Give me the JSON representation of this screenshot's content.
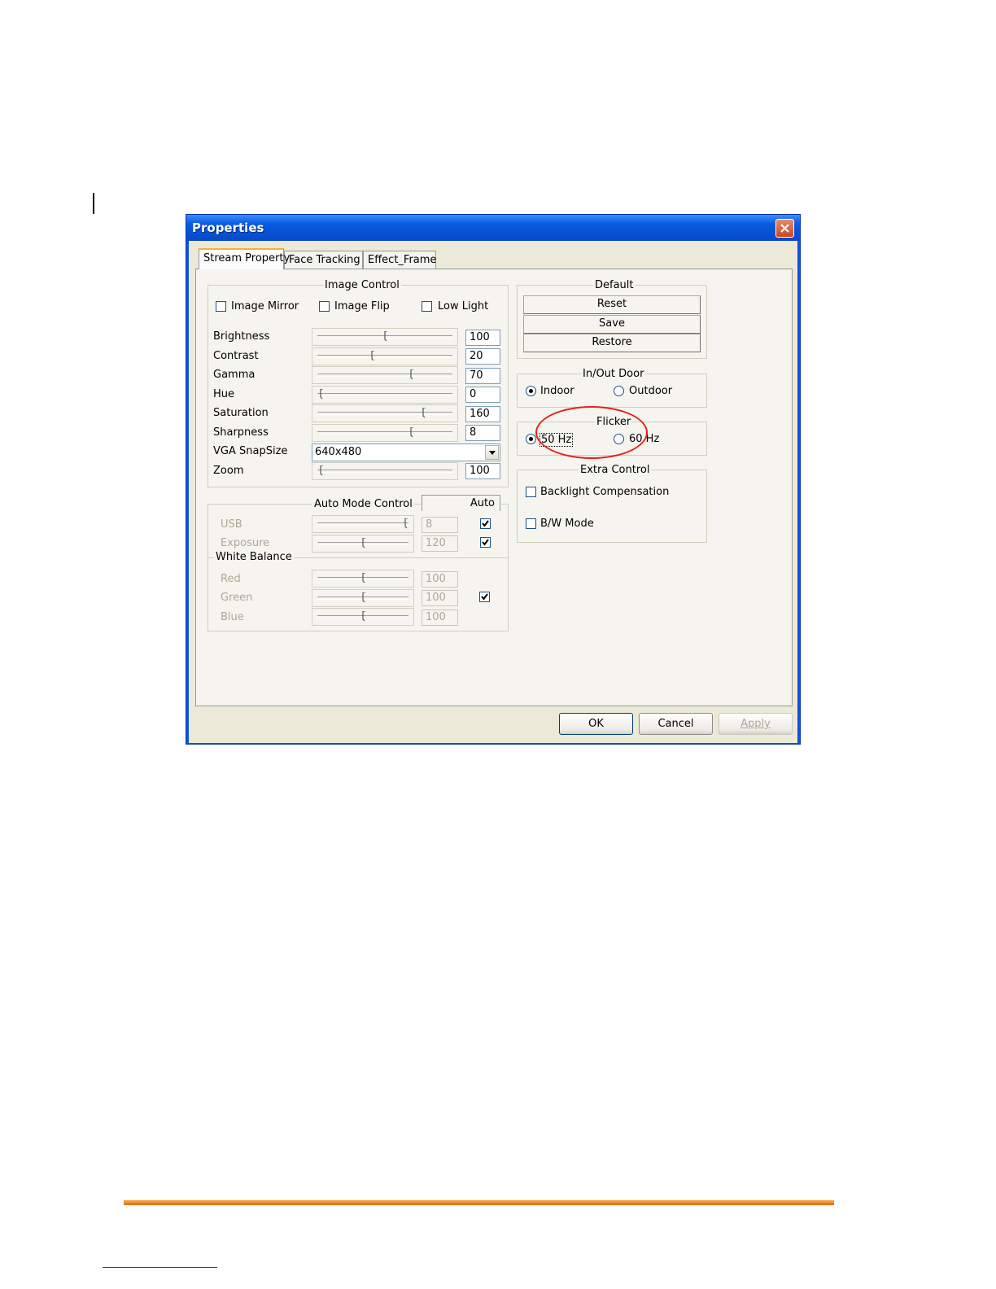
{
  "window": {
    "title": "Properties"
  },
  "tabs": [
    {
      "label": "Stream Property"
    },
    {
      "label": "Face Tracking"
    },
    {
      "label": "Effect_Frame"
    }
  ],
  "image_control": {
    "legend": "Image Control",
    "checkboxes": [
      {
        "label": "Image Mirror",
        "checked": false
      },
      {
        "label": "Image Flip",
        "checked": false
      },
      {
        "label": "Low Light",
        "checked": false
      }
    ],
    "sliders": [
      {
        "label": "Brightness",
        "value": "100",
        "level": 0.5
      },
      {
        "label": "Contrast",
        "value": "20",
        "level": 0.4
      },
      {
        "label": "Gamma",
        "value": "70",
        "level": 0.7
      },
      {
        "label": "Hue",
        "value": "0",
        "level": 0.0
      },
      {
        "label": "Saturation",
        "value": "160",
        "level": 0.8
      },
      {
        "label": "Sharpness",
        "value": "8",
        "level": 0.7
      }
    ],
    "snapsize": {
      "label": "VGA SnapSize",
      "value": "640x480"
    },
    "zoom": {
      "label": "Zoom",
      "value": "100",
      "level": 0.0
    }
  },
  "auto_mode": {
    "legend": "Auto Mode Control",
    "auto_header": "Auto",
    "rows": [
      {
        "label": "USB",
        "value": "8",
        "level": 1.0,
        "auto": true
      },
      {
        "label": "Exposure",
        "value": "120",
        "level": 0.5,
        "auto": true
      }
    ],
    "white_balance": {
      "legend": "White Balance",
      "auto": true,
      "rows": [
        {
          "label": "Red",
          "value": "100",
          "level": 0.5
        },
        {
          "label": "Green",
          "value": "100",
          "level": 0.5
        },
        {
          "label": "Blue",
          "value": "100",
          "level": 0.5
        }
      ]
    }
  },
  "default": {
    "legend": "Default",
    "reset": "Reset",
    "save": "Save",
    "restore": "Restore"
  },
  "inout": {
    "legend": "In/Out Door",
    "indoor": "Indoor",
    "outdoor": "Outdoor",
    "selected": "Indoor"
  },
  "flicker": {
    "legend": "Flicker",
    "hz50": "50 Hz",
    "hz60": "60 Hz",
    "selected": "50 Hz"
  },
  "extra": {
    "legend": "Extra Control",
    "backlight": "Backlight Compensation",
    "bw": "B/W Mode",
    "backlight_checked": false,
    "bw_checked": false
  },
  "footer": {
    "ok": "OK",
    "cancel": "Cancel",
    "apply": "Apply"
  },
  "colors": {
    "titlebar": "#0a5be0",
    "dialog_bg": "#ece9d8",
    "annotation": "#e2231a",
    "footer_rule": "#f39a3a"
  }
}
